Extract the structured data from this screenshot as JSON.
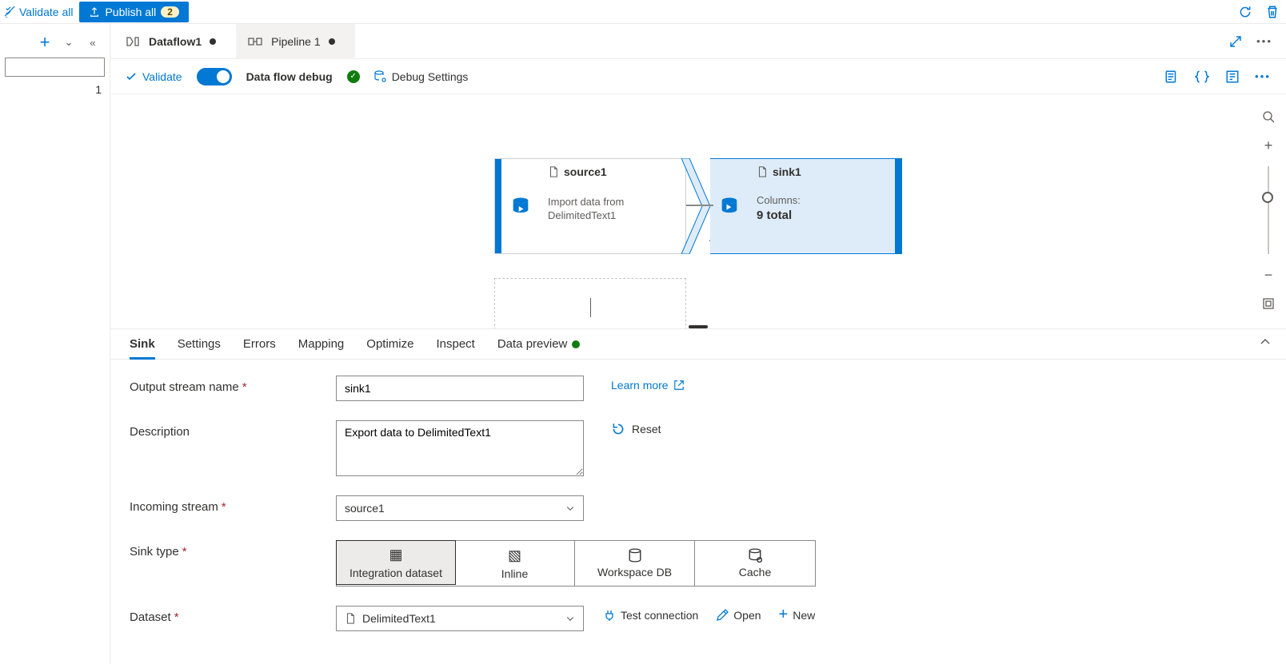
{
  "topbar": {
    "validate_all": "Validate all",
    "publish_all": "Publish all",
    "publish_count": "2"
  },
  "sidebar": {
    "count": "1"
  },
  "tabs": [
    {
      "label": "Dataflow1",
      "dirty": true
    },
    {
      "label": "Pipeline 1",
      "dirty": true
    }
  ],
  "toolbar": {
    "validate": "Validate",
    "debug_label": "Data flow debug",
    "debug_settings": "Debug Settings"
  },
  "graph": {
    "source": {
      "name": "source1",
      "desc": "Import data from DelimitedText1"
    },
    "sink": {
      "name": "sink1",
      "cols_label": "Columns:",
      "cols_value": "9 total"
    }
  },
  "panel": {
    "tabs": [
      "Sink",
      "Settings",
      "Errors",
      "Mapping",
      "Optimize",
      "Inspect",
      "Data preview"
    ],
    "active_tab": 0,
    "preview_ready": true,
    "labels": {
      "output_stream": "Output stream name",
      "description": "Description",
      "incoming": "Incoming stream",
      "sink_type": "Sink type",
      "dataset": "Dataset"
    },
    "values": {
      "output_stream": "sink1",
      "description": "Export data to DelimitedText1",
      "incoming": "source1",
      "dataset": "DelimitedText1"
    },
    "links": {
      "learn_more": "Learn more",
      "reset": "Reset"
    },
    "sink_types": [
      "Integration dataset",
      "Inline",
      "Workspace DB",
      "Cache"
    ],
    "dataset_actions": {
      "test": "Test connection",
      "open": "Open",
      "new": "New"
    }
  }
}
